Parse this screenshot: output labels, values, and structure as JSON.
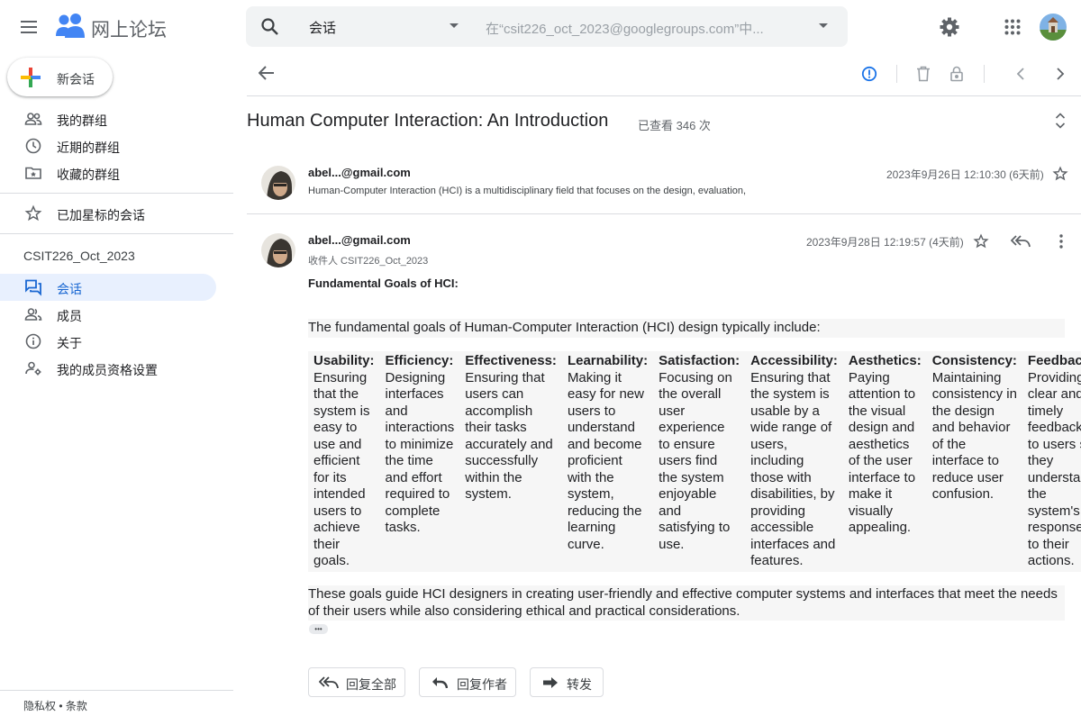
{
  "app": {
    "title": "网上论坛",
    "brand_color": "#4285f4"
  },
  "search": {
    "scope": "会话",
    "placeholder": "在“csit226_oct_2023@googlegroups.com”中..."
  },
  "sidebar": {
    "new_conversation": "新会话",
    "items": [
      {
        "label": "我的群组",
        "icon": "people-outline-icon"
      },
      {
        "label": "近期的群组",
        "icon": "clock-icon"
      },
      {
        "label": "收藏的群组",
        "icon": "folder-star-icon"
      },
      {
        "label": "已加星标的会话",
        "icon": "star-icon"
      }
    ],
    "group_name": "CSIT226_Oct_2023",
    "group_items": [
      {
        "label": "会话",
        "icon": "conversation-icon",
        "active": true
      },
      {
        "label": "成员",
        "icon": "members-icon"
      },
      {
        "label": "关于",
        "icon": "info-icon"
      },
      {
        "label": "我的成员资格设置",
        "icon": "member-settings-icon"
      }
    ],
    "footer": "隐私权 • 条款"
  },
  "thread": {
    "title": "Human Computer Interaction: An Introduction",
    "views": "已查看 346 次"
  },
  "messages": [
    {
      "sender": "abel...@gmail.com",
      "snippet": "Human-Computer Interaction (HCI) is a multidisciplinary field that focuses on the design, evaluation,",
      "timestamp": "2023年9月26日 12:10:30 (6天前)"
    },
    {
      "sender": "abel...@gmail.com",
      "recipient": "收件人 CSIT226_Oct_2023",
      "timestamp": "2023年9月28日 12:19:57 (4天前)",
      "heading": "Fundamental Goals of HCI:",
      "intro": "The fundamental goals of Human-Computer Interaction (HCI) design typically include:",
      "goals": [
        {
          "title": "Usability:",
          "desc": "Ensuring that the system is easy to use and efficient for its intended users to achieve their goals."
        },
        {
          "title": "Efficiency:",
          "desc": "Designing interfaces and interactions to minimize the time and effort required to complete tasks."
        },
        {
          "title": "Effectiveness:",
          "desc": "Ensuring that users can accomplish their tasks accurately and successfully within the system."
        },
        {
          "title": "Learnability:",
          "desc": "Making it easy for new users to understand and become proficient with the system, reducing the learning curve."
        },
        {
          "title": "Satisfaction:",
          "desc": "Focusing on the overall user experience to ensure users find the system enjoyable and satisfying to use."
        },
        {
          "title": "Accessibility:",
          "desc": "Ensuring that the system is usable by a wide range of users, including those with disabilities, by providing accessible interfaces and features."
        },
        {
          "title": "Aesthetics:",
          "desc": "Paying attention to the visual design and aesthetics of the user interface to make it visually appealing."
        },
        {
          "title": "Consistency:",
          "desc": "Maintaining consistency in the design and behavior of the interface to reduce user confusion."
        },
        {
          "title": "Feedback:",
          "desc": "Providing clear and timely feedback to users so they understand the system's responses to their actions."
        }
      ],
      "closing": "These goals guide HCI designers in creating user-friendly and effective computer systems and interfaces that meet the needs of their users while also considering ethical and practical considerations.",
      "more": "•••"
    }
  ],
  "actions": {
    "reply_all": "回复全部",
    "reply_author": "回复作者",
    "forward": "转发"
  }
}
